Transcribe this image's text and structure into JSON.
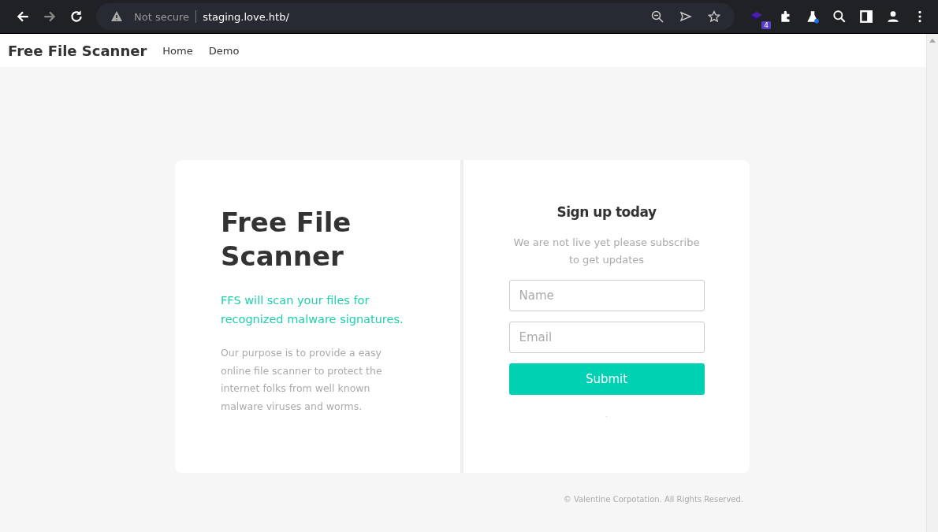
{
  "browser": {
    "security": "Not secure",
    "url": "staging.love.htb/",
    "extension_badge": "4"
  },
  "navbar": {
    "brand": "Free File Scanner",
    "links": [
      {
        "label": "Home"
      },
      {
        "label": "Demo"
      }
    ]
  },
  "hero": {
    "title": "Free File Scanner",
    "tagline": "FFS will scan your files for recognized malware signatures.",
    "description": "Our purpose is to provide a easy online file scanner to protect the internet folks from well known malware viruses and worms."
  },
  "signup": {
    "title": "Sign up today",
    "subtitle": "We are not live yet please subscribe to get updates",
    "fields": [
      {
        "placeholder": "Name"
      },
      {
        "placeholder": "Email"
      }
    ],
    "button": "Submit",
    "status": "."
  },
  "footer": "© Valentine Corpotation. All Rights Reserved."
}
